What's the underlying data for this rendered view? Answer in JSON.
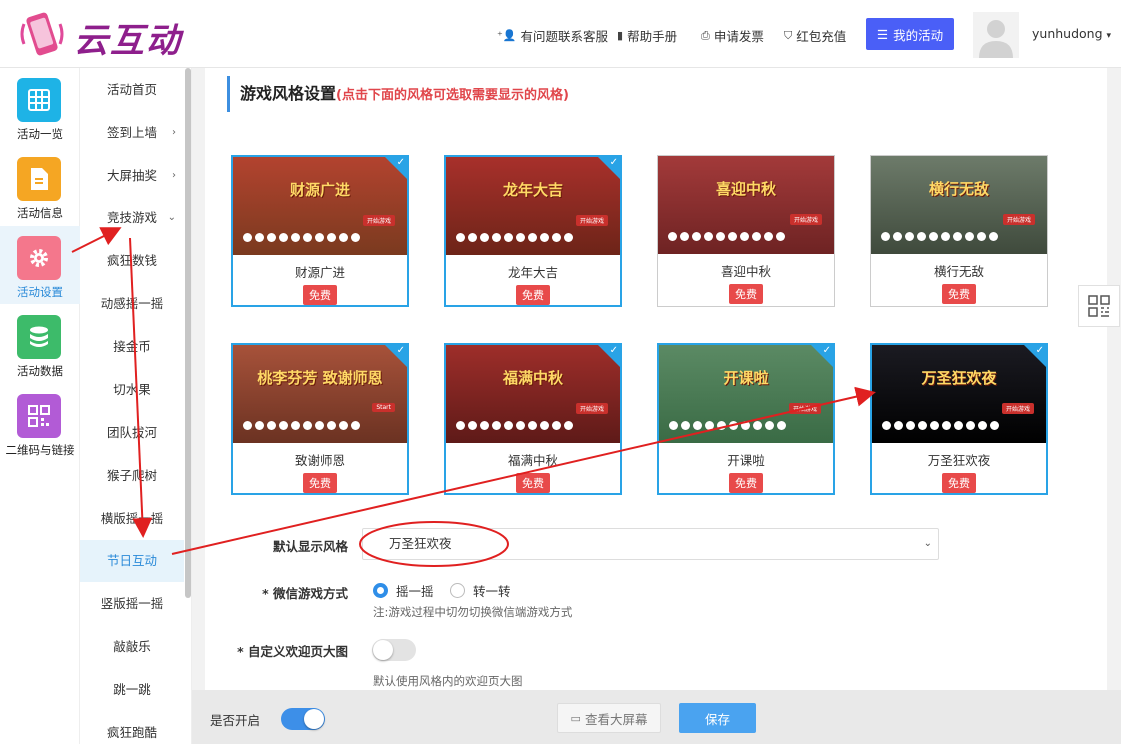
{
  "header": {
    "logo_text": "云互动",
    "nav": [
      {
        "icon": "user-plus-icon",
        "label": "有问题联系客服"
      },
      {
        "icon": "book-icon",
        "label": "帮助手册"
      },
      {
        "icon": "printer-icon",
        "label": "申请发票"
      },
      {
        "icon": "shield-check-icon",
        "label": "红包充值"
      }
    ],
    "my_activity": "我的活动",
    "username": "yunhudong"
  },
  "left_sidebar": [
    {
      "label": "活动一览",
      "icon": "grid-icon",
      "color": "#1eb3e6"
    },
    {
      "label": "活动信息",
      "icon": "document-icon",
      "color": "#f5a623"
    },
    {
      "label": "活动设置",
      "icon": "gear-icon",
      "color": "#f4778c",
      "active": true
    },
    {
      "label": "活动数据",
      "icon": "database-icon",
      "color": "#3dbb6a"
    },
    {
      "label": "二维码与链接",
      "icon": "qrcode-icon",
      "color": "#b25bd6"
    }
  ],
  "sub_menu": [
    {
      "label": "活动首页"
    },
    {
      "label": "签到上墙",
      "chev": "›"
    },
    {
      "label": "大屏抽奖",
      "chev": "›"
    },
    {
      "label": "竞技游戏",
      "chev": "⌄"
    },
    {
      "label": "疯狂数钱"
    },
    {
      "label": "动感摇一摇"
    },
    {
      "label": "接金币"
    },
    {
      "label": "切水果"
    },
    {
      "label": "团队拔河"
    },
    {
      "label": "猴子爬树"
    },
    {
      "label": "横版摇一摇"
    },
    {
      "label": "节日互动",
      "active": true
    },
    {
      "label": "竖版摇一摇"
    },
    {
      "label": "敲敲乐"
    },
    {
      "label": "跳一跳"
    },
    {
      "label": "疯狂跑酷"
    }
  ],
  "section": {
    "title": "游戏风格设置",
    "hint": "(点击下面的风格可选取需要显示的风格)"
  },
  "styles": [
    {
      "name": "财源广进",
      "badge": "免费",
      "selected": true,
      "banner": "财源广进",
      "bg": "#b3432f",
      "bg2": "#7a3a1f",
      "btn": "开始游戏"
    },
    {
      "name": "龙年大吉",
      "badge": "免费",
      "selected": true,
      "banner": "龙年大吉",
      "bg": "#a8302b",
      "bg2": "#6d2418",
      "btn": "开始游戏"
    },
    {
      "name": "喜迎中秋",
      "badge": "免费",
      "selected": false,
      "banner": "喜迎中秋",
      "bg": "#a33a3a",
      "bg2": "#6e2323",
      "btn": "开始游戏"
    },
    {
      "name": "横行无敌",
      "badge": "免费",
      "selected": false,
      "banner": "横行无敌",
      "bg": "#6d7b6a",
      "bg2": "#3f4a3c",
      "btn": "开始游戏"
    },
    {
      "name": "致谢师恩",
      "badge": "免费",
      "selected": true,
      "banner": "桃李芬芳 致谢师恩",
      "bg": "#a7523a",
      "bg2": "#6b3222",
      "btn": "Start"
    },
    {
      "name": "福满中秋",
      "badge": "免费",
      "selected": true,
      "banner": "福满中秋",
      "bg": "#9e2e2a",
      "bg2": "#5e1a18",
      "btn": "开始游戏"
    },
    {
      "name": "开课啦",
      "badge": "免费",
      "selected": true,
      "banner": "开课啦",
      "bg": "#5b8a64",
      "bg2": "#3a6b45",
      "btn": "开始游戏"
    },
    {
      "name": "万圣狂欢夜",
      "badge": "免费",
      "selected": true,
      "banner": "万圣狂欢夜",
      "bg": "#1b1b22",
      "bg2": "#000000",
      "btn": "开始游戏"
    }
  ],
  "form": {
    "default_style_label": "默认显示风格",
    "default_style_value": "万圣狂欢夜",
    "wechat_mode_label": "* 微信游戏方式",
    "mode_options": [
      "摇一摇",
      "转一转"
    ],
    "mode_selected": 0,
    "mode_note": "注:游戏过程中切勿切换微信端游戏方式",
    "welcome_label": "* 自定义欢迎页大图",
    "welcome_on": false,
    "welcome_note": "默认使用风格内的欢迎页大图"
  },
  "footer": {
    "enable_label": "是否开启",
    "enable_on": true,
    "preview_label": "查看大屏幕",
    "save_label": "保存"
  }
}
